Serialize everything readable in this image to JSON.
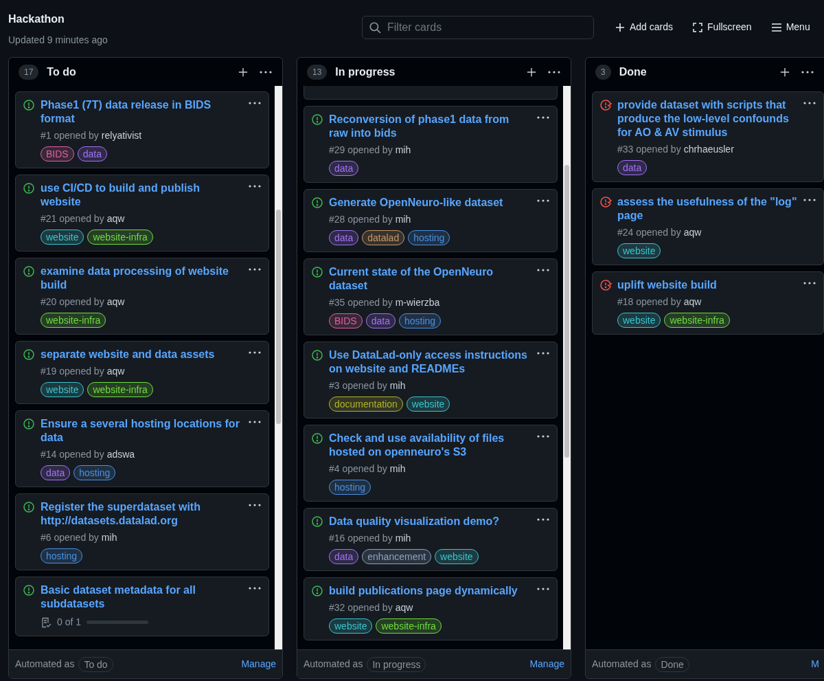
{
  "board": {
    "title": "Hackathon",
    "updated": "Updated 9 minutes ago"
  },
  "search": {
    "placeholder": "Filter cards"
  },
  "actions": [
    {
      "kind": "add",
      "label": "Add cards"
    },
    {
      "kind": "fullscreen",
      "label": "Fullscreen"
    },
    {
      "kind": "menu",
      "label": "Menu"
    }
  ],
  "columns": [
    {
      "count": "17",
      "name": "To do",
      "scrollable": true,
      "partial_top": false,
      "cards": [
        {
          "closed": false,
          "title": "Phase1 (7T) data release in BIDS format",
          "number": "#1",
          "opened": "opened by",
          "author": "relyativist",
          "labels": [
            {
              "text": "BIDS",
              "color": "#db61a2"
            },
            {
              "text": "data",
              "color": "#a371f7"
            }
          ]
        },
        {
          "closed": false,
          "title": "use CI/CD to build and publish website",
          "number": "#21",
          "opened": "opened by",
          "author": "aqw",
          "labels": [
            {
              "text": "website",
              "color": "#39c5cf"
            },
            {
              "text": "website-infra",
              "color": "#6fdd3d"
            }
          ]
        },
        {
          "closed": false,
          "title": "examine data processing of website build",
          "number": "#20",
          "opened": "opened by",
          "author": "aqw",
          "labels": [
            {
              "text": "website-infra",
              "color": "#6fdd3d"
            }
          ]
        },
        {
          "closed": false,
          "title": "separate website and data assets",
          "number": "#19",
          "opened": "opened by",
          "author": "aqw",
          "labels": [
            {
              "text": "website",
              "color": "#39c5cf"
            },
            {
              "text": "website-infra",
              "color": "#6fdd3d"
            }
          ]
        },
        {
          "closed": false,
          "title": "Ensure a several hosting locations for data",
          "number": "#14",
          "opened": "opened by",
          "author": "adswa",
          "labels": [
            {
              "text": "data",
              "color": "#a371f7"
            },
            {
              "text": "hosting",
              "color": "#4a90e2"
            }
          ]
        },
        {
          "closed": false,
          "title": "Register the superdataset with http://datasets.datalad.org",
          "number": "#6",
          "opened": "opened by",
          "author": "mih",
          "labels": [
            {
              "text": "hosting",
              "color": "#4a90e2"
            }
          ]
        },
        {
          "closed": false,
          "title": "Basic dataset metadata for all subdatasets",
          "tasks": {
            "text": "0 of 1",
            "level": 0
          }
        }
      ]
    },
    {
      "count": "13",
      "name": "In progress",
      "scrollable": true,
      "partial_top": true,
      "cards": [
        {
          "closed": false,
          "title": "Reconversion of phase1 data from raw into bids",
          "number": "#29",
          "opened": "opened by",
          "author": "mih",
          "labels": [
            {
              "text": "data",
              "color": "#a371f7"
            }
          ]
        },
        {
          "closed": false,
          "title": "Generate OpenNeuro-like dataset",
          "number": "#28",
          "opened": "opened by",
          "author": "mih",
          "labels": [
            {
              "text": "data",
              "color": "#a371f7"
            },
            {
              "text": "datalad",
              "color": "#c69968"
            },
            {
              "text": "hosting",
              "color": "#4a90e2"
            }
          ]
        },
        {
          "closed": false,
          "title": "Current state of the OpenNeuro dataset",
          "number": "#35",
          "opened": "opened by",
          "author": "m-wierzba",
          "labels": [
            {
              "text": "BIDS",
              "color": "#db61a2"
            },
            {
              "text": "data",
              "color": "#a371f7"
            },
            {
              "text": "hosting",
              "color": "#4a90e2"
            }
          ]
        },
        {
          "closed": false,
          "title": "Use DataLad-only access instructions on website and READMEs",
          "number": "#3",
          "opened": "opened by",
          "author": "mih",
          "labels": [
            {
              "text": "documentation",
              "color": "#b3b32a"
            },
            {
              "text": "website",
              "color": "#39c5cf"
            }
          ]
        },
        {
          "closed": false,
          "title": "Check and use availability of files hosted on openneuro's S3",
          "number": "#4",
          "opened": "opened by",
          "author": "mih",
          "labels": [
            {
              "text": "hosting",
              "color": "#4a90e2"
            }
          ]
        },
        {
          "closed": false,
          "title": "Data quality visualization demo?",
          "number": "#16",
          "opened": "opened by",
          "author": "mih",
          "labels": [
            {
              "text": "data",
              "color": "#a371f7"
            },
            {
              "text": "enhancement",
              "color": "#8aa3c2"
            },
            {
              "text": "website",
              "color": "#39c5cf"
            }
          ]
        },
        {
          "closed": false,
          "title": "build publications page dynamically",
          "number": "#32",
          "opened": "opened by",
          "author": "aqw",
          "labels": [
            {
              "text": "website",
              "color": "#39c5cf"
            },
            {
              "text": "website-infra",
              "color": "#6fdd3d"
            }
          ]
        }
      ]
    },
    {
      "count": "3",
      "name": "Done",
      "scrollable": false,
      "partial_top": false,
      "cards": [
        {
          "closed": true,
          "title": "provide dataset with scripts that produce the low-level confounds for AO & AV stimulus",
          "number": "#33",
          "opened": "opened by",
          "author": "chrhaeusler",
          "labels": [
            {
              "text": "data",
              "color": "#a371f7"
            }
          ]
        },
        {
          "closed": true,
          "title": "assess the usefulness of the \"log\" page",
          "number": "#24",
          "opened": "opened by",
          "author": "aqw",
          "labels": [
            {
              "text": "website",
              "color": "#39c5cf"
            }
          ]
        },
        {
          "closed": true,
          "title": "uplift website build",
          "number": "#18",
          "opened": "opened by",
          "author": "aqw",
          "labels": [
            {
              "text": "website",
              "color": "#39c5cf"
            },
            {
              "text": "website-infra",
              "color": "#6fdd3d"
            }
          ]
        }
      ]
    }
  ],
  "footers": [
    {
      "text": "Automated as",
      "badge": "To do",
      "link": "Manage"
    },
    {
      "text": "Automated as",
      "badge": "In progress",
      "link": "Manage"
    },
    {
      "text": "Automated as",
      "badge": "Done",
      "link": "M"
    }
  ]
}
